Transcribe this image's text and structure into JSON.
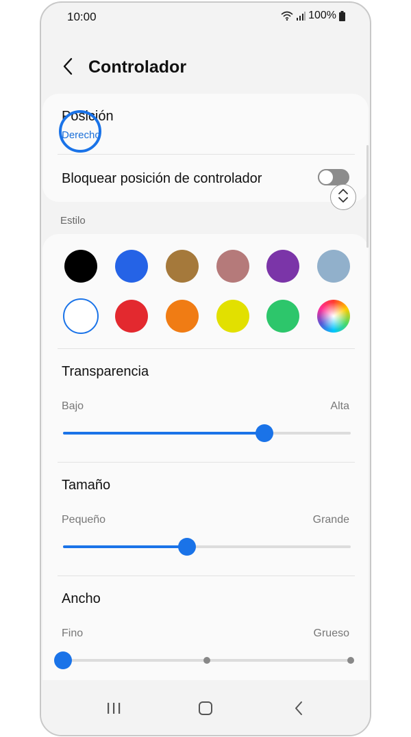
{
  "status_bar": {
    "time": "10:00",
    "battery": "100%"
  },
  "header": {
    "title": "Controlador"
  },
  "position_row": {
    "label": "Posición",
    "value": "Derecho"
  },
  "lock_row": {
    "label": "Bloquear posición de controlador",
    "enabled": false
  },
  "style_section": {
    "label": "Estilo",
    "swatches": [
      {
        "name": "black",
        "color": "#000000"
      },
      {
        "name": "blue",
        "color": "#2563e6"
      },
      {
        "name": "brown",
        "color": "#a5793b"
      },
      {
        "name": "rose",
        "color": "#b57a7a"
      },
      {
        "name": "purple",
        "color": "#7b35a8"
      },
      {
        "name": "light-blue",
        "color": "#91b0cb"
      },
      {
        "name": "white",
        "color": "#ffffff",
        "selected": true
      },
      {
        "name": "red",
        "color": "#e3292f"
      },
      {
        "name": "orange",
        "color": "#f07c14"
      },
      {
        "name": "yellow",
        "color": "#e2e000"
      },
      {
        "name": "green",
        "color": "#2dc66b"
      },
      {
        "name": "custom",
        "color": "multicolor"
      }
    ]
  },
  "transparency": {
    "title": "Transparencia",
    "min_label": "Bajo",
    "max_label": "Alta",
    "value_fraction": 0.7
  },
  "size": {
    "title": "Tamaño",
    "min_label": "Pequeño",
    "max_label": "Grande",
    "value_fraction": 0.43
  },
  "width": {
    "title": "Ancho",
    "min_label": "Fino",
    "max_label": "Grueso",
    "steps": 3,
    "value_step": 0
  },
  "accent_color": "#1a73e8"
}
